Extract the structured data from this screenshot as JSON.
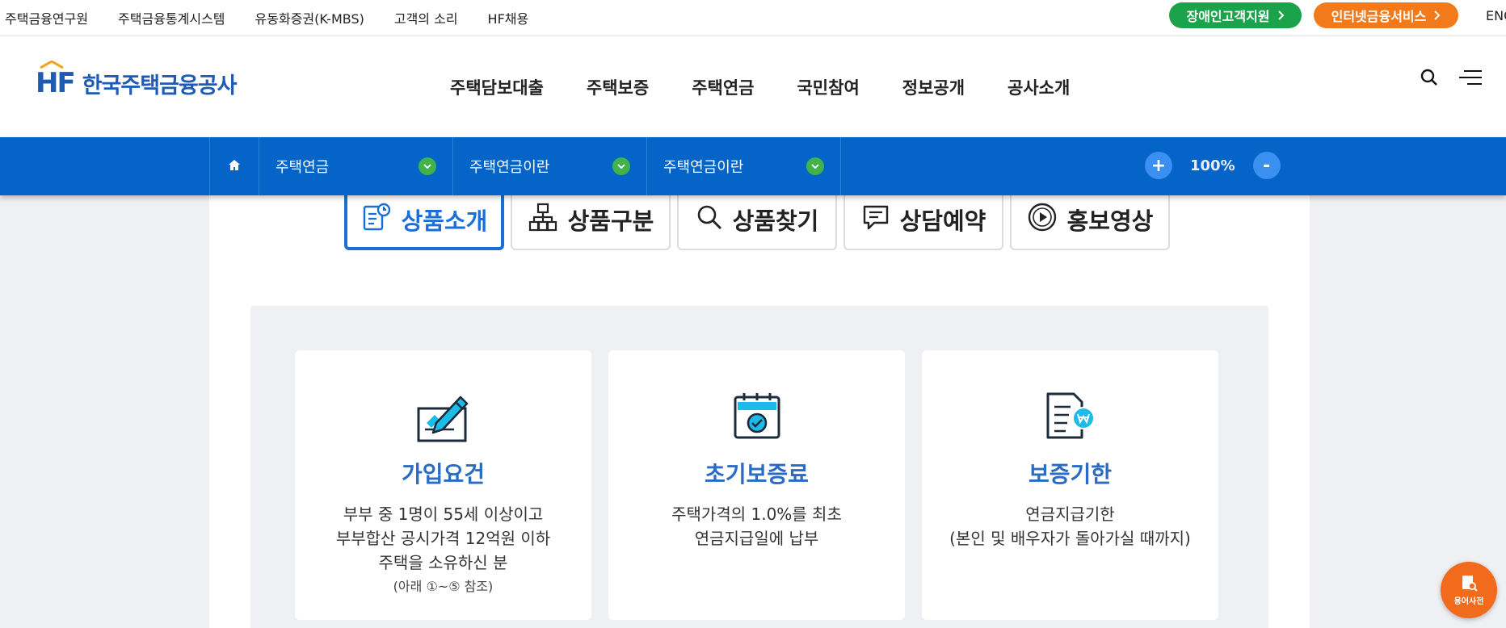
{
  "top_links": [
    "주택금융연구원",
    "주택금융통계시스템",
    "유동화증권(K-MBS)",
    "고객의 소리",
    "HF채용"
  ],
  "top_buttons": {
    "accessibility": "장애인고객지원",
    "internet": "인터넷금융서비스",
    "lang": "ENG"
  },
  "logo": {
    "mark": "HF",
    "name": "한국주택금융공사"
  },
  "gnb": [
    "주택담보대출",
    "주택보증",
    "주택연금",
    "국민참여",
    "정보공개",
    "공사소개"
  ],
  "breadcrumb": [
    "주택연금",
    "주택연금이란",
    "주택연금이란"
  ],
  "zoom": {
    "level": "100%",
    "plus": "+",
    "minus": "-"
  },
  "tabs": [
    {
      "label": "상품소개",
      "icon": "clipboard-clock-icon",
      "active": true
    },
    {
      "label": "상품구분",
      "icon": "hierarchy-icon",
      "active": false
    },
    {
      "label": "상품찾기",
      "icon": "search-icon",
      "active": false
    },
    {
      "label": "상담예약",
      "icon": "chat-bubble-icon",
      "active": false
    },
    {
      "label": "홍보영상",
      "icon": "play-circle-icon",
      "active": false
    }
  ],
  "cards": [
    {
      "title": "가입요건",
      "icon": "signature-pen-icon",
      "lines": [
        "부부 중 1명이 55세 이상이고",
        "부부합산 공시가격 12억원 이하",
        "주택을 소유하신 분"
      ],
      "note": "(아래 ①~⑤ 참조)"
    },
    {
      "title": "초기보증료",
      "icon": "calendar-check-icon",
      "lines": [
        "주택가격의 1.0%를 최초",
        "연금지급일에 납부"
      ]
    },
    {
      "title": "보증기한",
      "icon": "document-won-icon",
      "lines": [
        "연금지급기한",
        "(본인 및 배우자가 돌아가실 때까지)"
      ]
    }
  ],
  "fab_label": "용어사전",
  "colors": {
    "primary": "#0564c8",
    "accent_blue": "#1a6fd6",
    "green": "#1aa34a",
    "orange": "#f27a1a",
    "card_title": "#2a6bc6"
  }
}
